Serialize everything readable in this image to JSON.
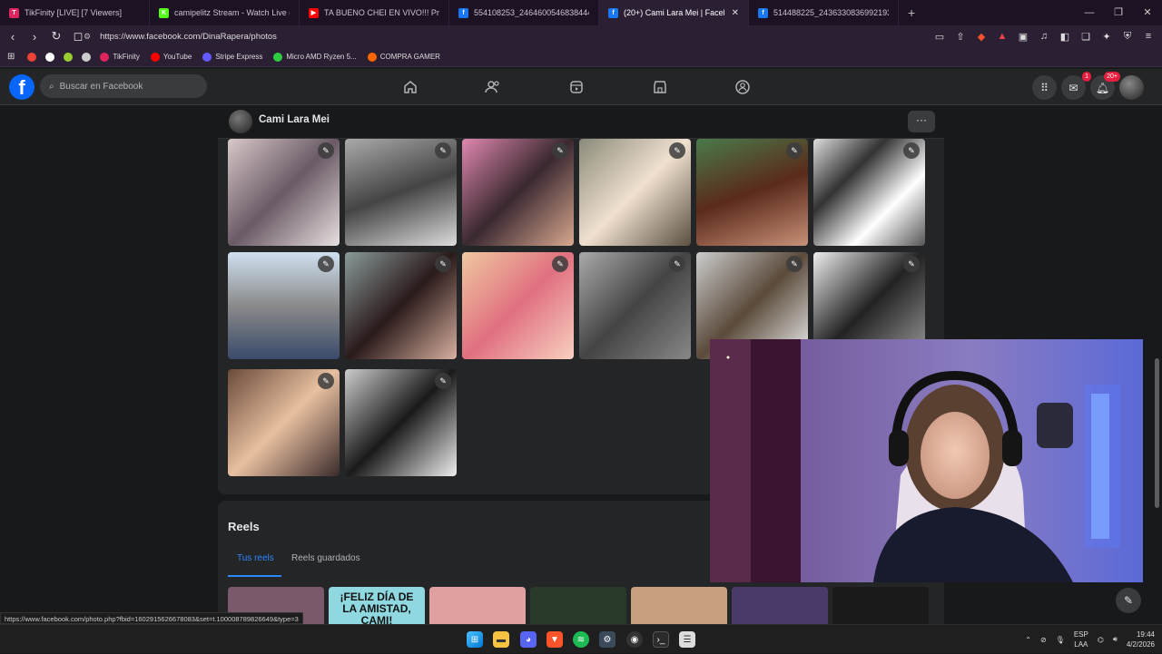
{
  "browser": {
    "tabs": [
      {
        "title": "TikFinity [LIVE] [7 Viewers]",
        "fav_color": "#e0245e",
        "fav_glyph": "T"
      },
      {
        "title": "camipelitz Stream - Watch Live on Ki",
        "fav_color": "#53fc18",
        "fav_glyph": "K"
      },
      {
        "title": "TA BUENO CHEI EN VIVO!!! Programa",
        "fav_color": "#ff0000",
        "fav_glyph": "▶"
      },
      {
        "title": "554108253_246460054683844418_6020",
        "fav_color": "#1877f2",
        "fav_glyph": "f"
      },
      {
        "title": "(20+) Cami Lara Mei | Facebook",
        "fav_color": "#1877f2",
        "fav_glyph": "f",
        "active": true
      },
      {
        "title": "514488225_243633083699219322_2763",
        "fav_color": "#1877f2",
        "fav_glyph": "f"
      }
    ],
    "new_tab": "+",
    "url": "https://www.facebook.com/DinaRapera/photos",
    "bookmarks": [
      {
        "label": "",
        "color": "#ea4335"
      },
      {
        "label": "",
        "color": "#ffffff"
      },
      {
        "label": "",
        "color": "#9acd32"
      },
      {
        "label": "",
        "color": "#cccccc"
      },
      {
        "label": "TikFinity",
        "color": "#e0245e"
      },
      {
        "label": "YouTube",
        "color": "#ff0000"
      },
      {
        "label": "Stripe Express",
        "color": "#635bff"
      },
      {
        "label": "Micro AMD Ryzen 5...",
        "color": "#2ecc40"
      },
      {
        "label": "COMPRA GAMER",
        "color": "#ff6600"
      }
    ]
  },
  "facebook": {
    "search_placeholder": "Buscar en Facebook",
    "messenger_badge": "1",
    "notifications_badge": "20+",
    "profile_name": "Cami Lara Mei",
    "more_label": "···",
    "reels_title": "Reels",
    "reels_tabs": [
      "Tus reels",
      "Reels guardados"
    ],
    "reel_texts": [
      "",
      "¡FELIZ DÍA DE LA AMISTAD, CAMI!",
      "",
      "",
      "",
      "",
      ""
    ],
    "status_url": "https://www.facebook.com/photo.php?fbid=1602915626678083&set=t.100008789826649&type=3"
  },
  "taskbar": {
    "lang_top": "ESP",
    "lang_bottom": "LAA",
    "time": "19:44",
    "date": "4/2/2026"
  }
}
